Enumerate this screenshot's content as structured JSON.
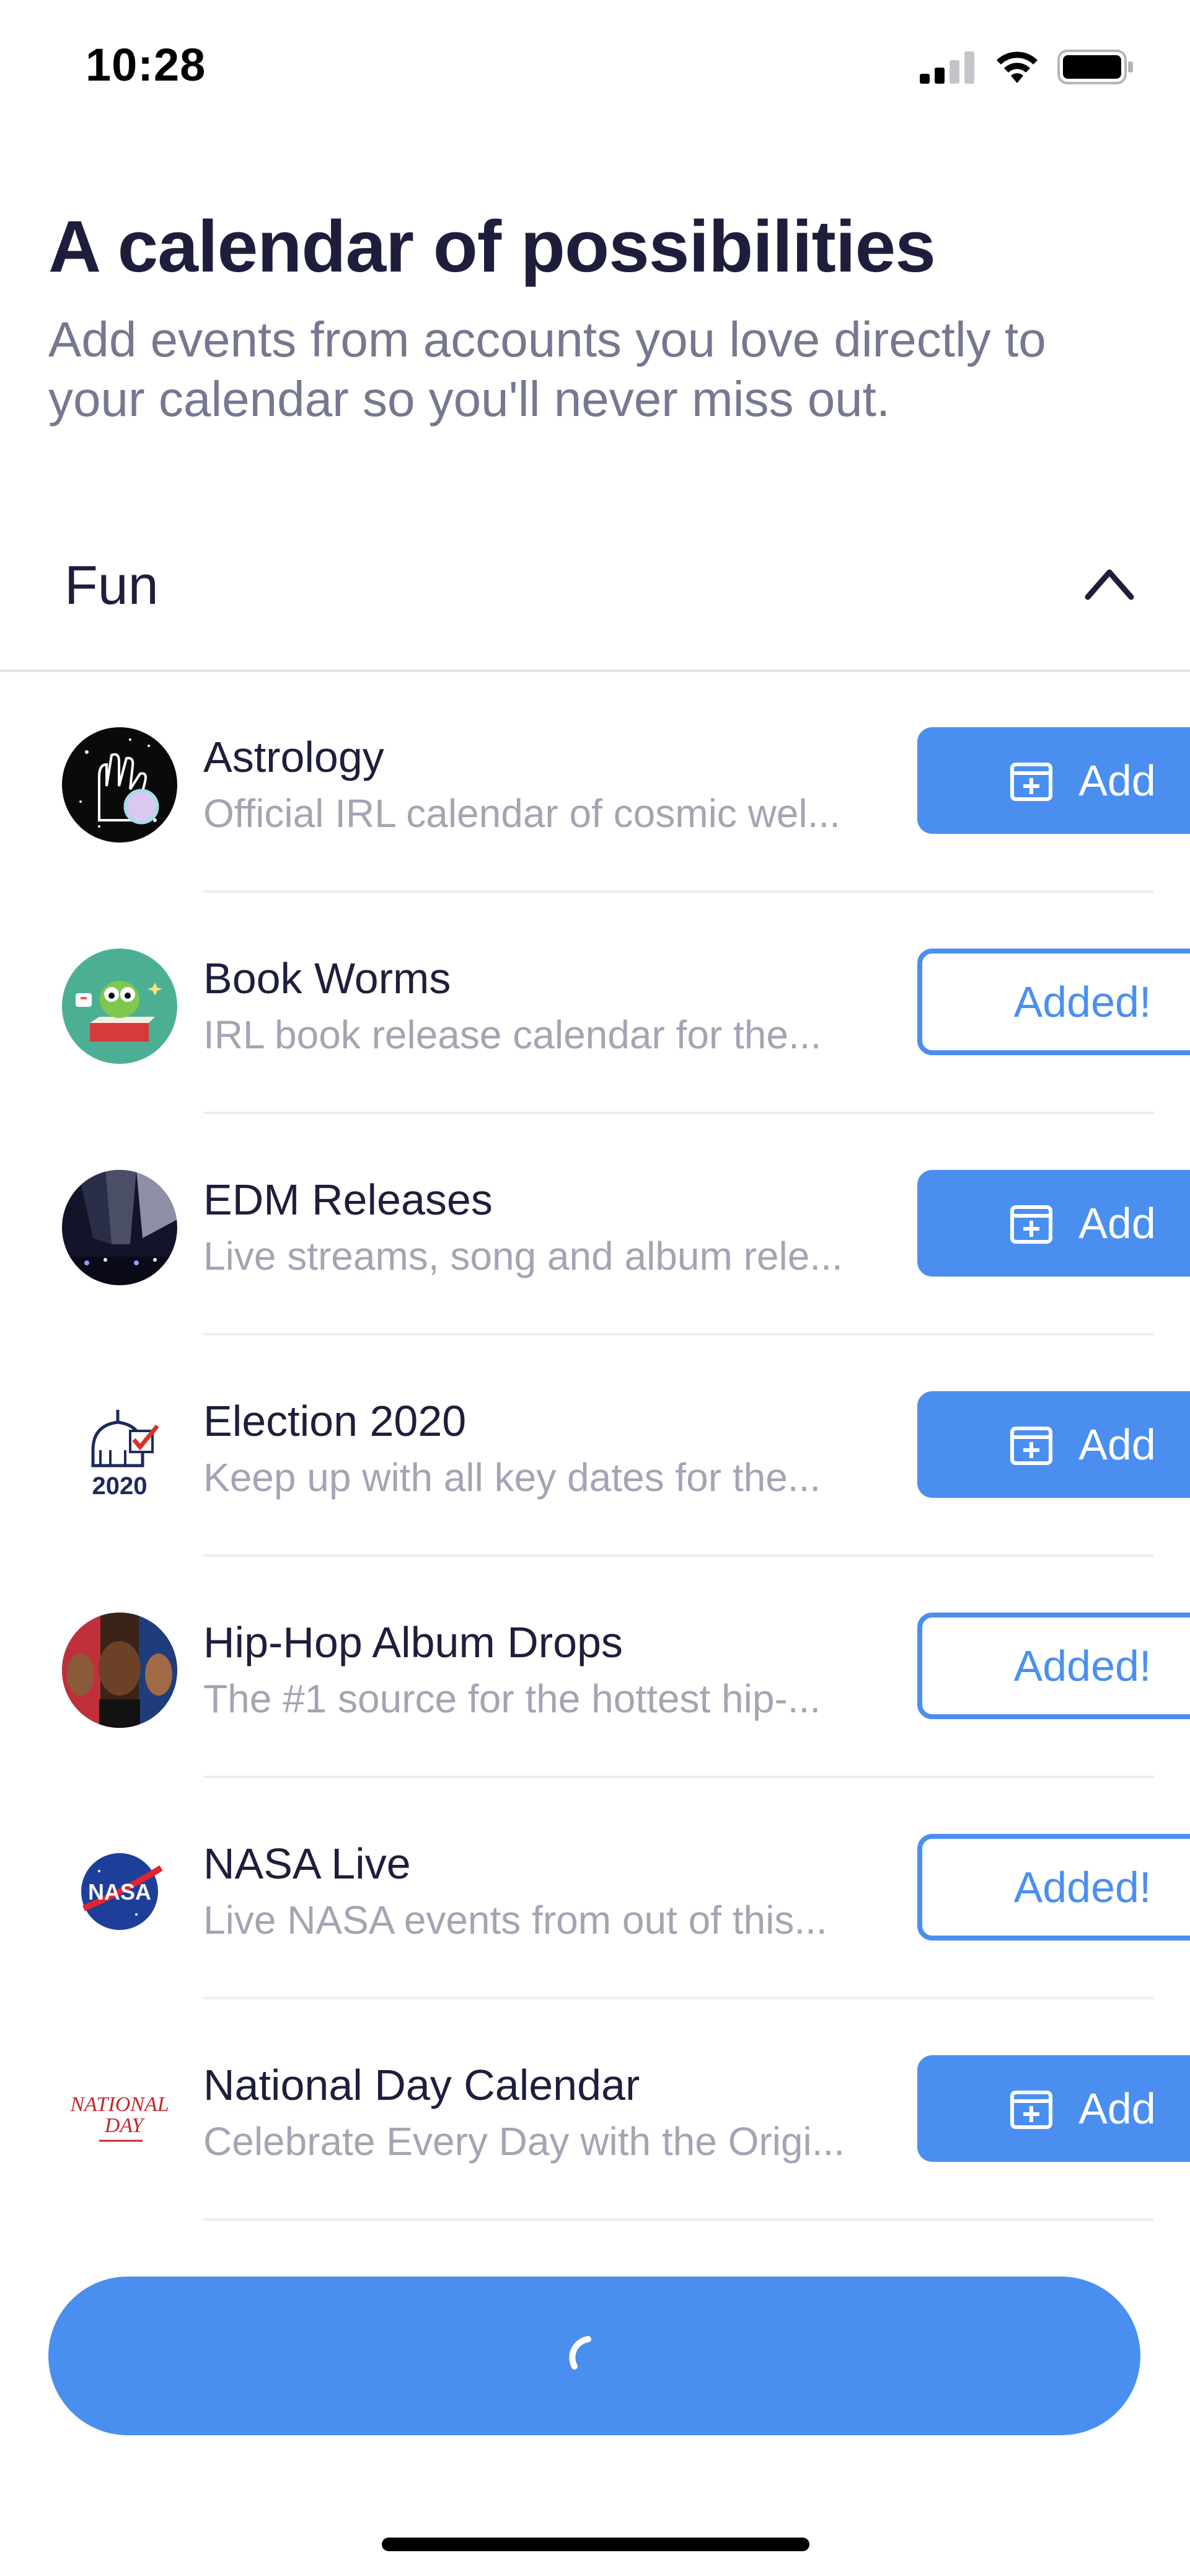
{
  "status_bar": {
    "time": "10:28"
  },
  "header": {
    "title": "A calendar of possibilities",
    "subtitle": "Add events from accounts you love directly to your calendar so you'll never miss out."
  },
  "section": {
    "title": "Fun"
  },
  "add_label": "Add",
  "added_label": "Added!",
  "calendars": [
    {
      "name": "Astrology",
      "description": "Official IRL calendar of cosmic wel...",
      "added": false
    },
    {
      "name": "Book Worms",
      "description": "IRL book release calendar for the...",
      "added": true
    },
    {
      "name": "EDM Releases",
      "description": "Live streams, song and album rele...",
      "added": false
    },
    {
      "name": "Election 2020",
      "description": "Keep up with all key dates for the...",
      "added": false
    },
    {
      "name": "Hip-Hop Album Drops",
      "description": "The #1 source for the hottest hip-...",
      "added": true
    },
    {
      "name": "NASA Live",
      "description": "Live NASA events from out of this...",
      "added": true
    },
    {
      "name": "National Day Calendar",
      "description": "Celebrate Every Day with the Origi...",
      "added": false
    }
  ],
  "icons": {
    "election": "2020",
    "nasa": "NASA",
    "national_day": [
      "NATIONAL",
      "DAY"
    ]
  },
  "colors": {
    "accent": "#4a8ff0",
    "title": "#1e1e3c",
    "subtitle": "#767890",
    "muted": "#a3a5b4"
  }
}
